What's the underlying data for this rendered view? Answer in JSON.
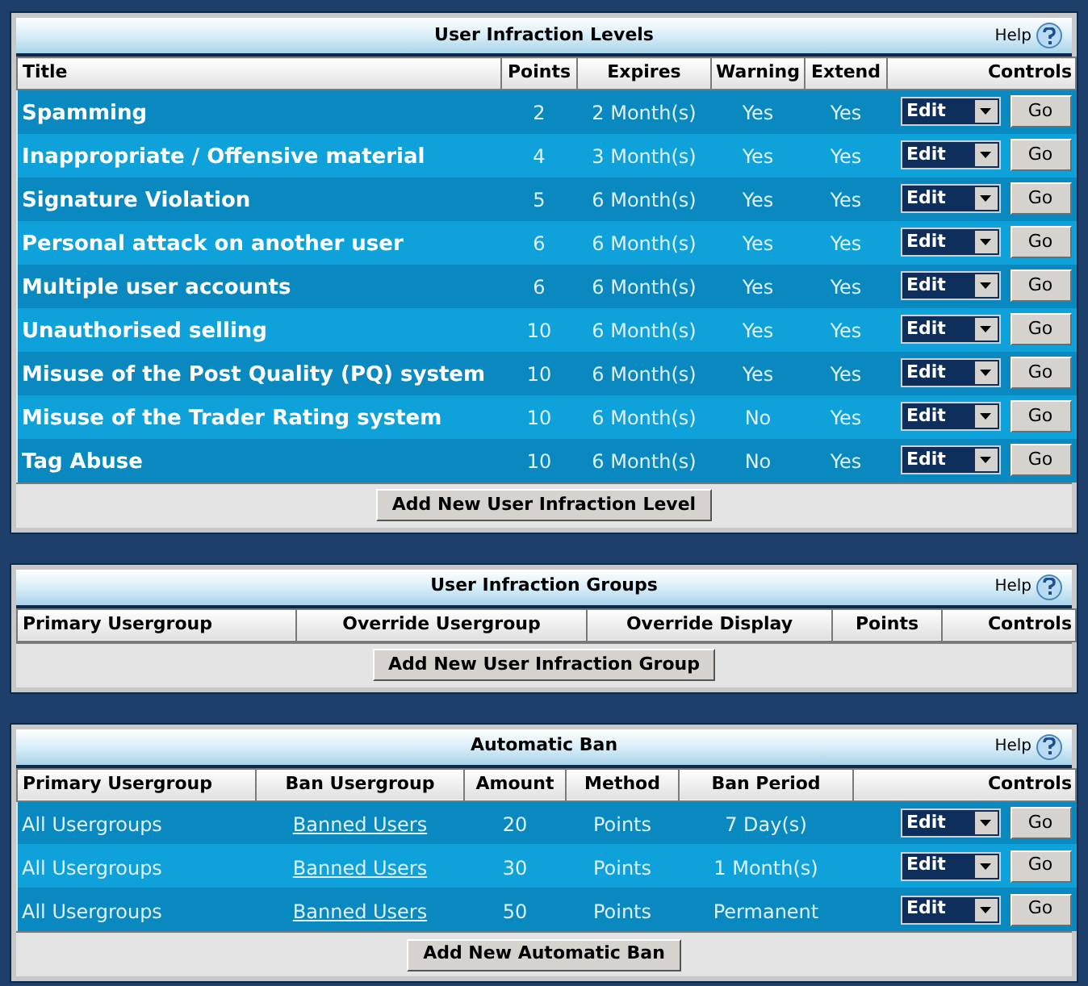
{
  "sections": [
    {
      "title": "User Infraction Levels",
      "help": "Help",
      "columns": [
        {
          "label": "Title",
          "kind": "title"
        },
        {
          "label": "Points",
          "kind": "text"
        },
        {
          "label": "Expires",
          "kind": "text"
        },
        {
          "label": "Warning",
          "kind": "text"
        },
        {
          "label": "Extend",
          "kind": "text"
        },
        {
          "label": "Controls",
          "kind": "controls"
        }
      ],
      "rows": [
        {
          "cells": [
            "Spamming",
            "2",
            "2 Month(s)",
            "Yes",
            "Yes"
          ],
          "select": "Edit",
          "button": "Go"
        },
        {
          "cells": [
            "Inappropriate / Offensive material",
            "4",
            "3 Month(s)",
            "Yes",
            "Yes"
          ],
          "select": "Edit",
          "button": "Go"
        },
        {
          "cells": [
            "Signature Violation",
            "5",
            "6 Month(s)",
            "Yes",
            "Yes"
          ],
          "select": "Edit",
          "button": "Go"
        },
        {
          "cells": [
            "Personal attack on another user",
            "6",
            "6 Month(s)",
            "Yes",
            "Yes"
          ],
          "select": "Edit",
          "button": "Go"
        },
        {
          "cells": [
            "Multiple user accounts",
            "6",
            "6 Month(s)",
            "Yes",
            "Yes"
          ],
          "select": "Edit",
          "button": "Go"
        },
        {
          "cells": [
            "Unauthorised selling",
            "10",
            "6 Month(s)",
            "Yes",
            "Yes"
          ],
          "select": "Edit",
          "button": "Go"
        },
        {
          "cells": [
            "Misuse of the Post Quality (PQ) system",
            "10",
            "6 Month(s)",
            "Yes",
            "Yes"
          ],
          "select": "Edit",
          "button": "Go"
        },
        {
          "cells": [
            "Misuse of the Trader Rating system",
            "10",
            "6 Month(s)",
            "No",
            "Yes"
          ],
          "select": "Edit",
          "button": "Go"
        },
        {
          "cells": [
            "Tag Abuse",
            "10",
            "6 Month(s)",
            "No",
            "Yes"
          ],
          "select": "Edit",
          "button": "Go"
        }
      ],
      "add_button": "Add New User Infraction Level"
    },
    {
      "title": "User Infraction Groups",
      "help": "Help",
      "columns": [
        {
          "label": "Primary Usergroup",
          "kind": "first"
        },
        {
          "label": "Override Usergroup",
          "kind": "text"
        },
        {
          "label": "Override Display",
          "kind": "text"
        },
        {
          "label": "Points",
          "kind": "text"
        },
        {
          "label": "Controls",
          "kind": "controls"
        }
      ],
      "add_button": "Add New User Infraction Group"
    },
    {
      "title": "Automatic Ban",
      "help": "Help",
      "columns": [
        {
          "label": "Primary Usergroup",
          "kind": "first"
        },
        {
          "label": "Ban Usergroup",
          "kind": "link"
        },
        {
          "label": "Amount",
          "kind": "text"
        },
        {
          "label": "Method",
          "kind": "text"
        },
        {
          "label": "Ban Period",
          "kind": "text"
        },
        {
          "label": "Controls",
          "kind": "controls"
        }
      ],
      "rows": [
        {
          "cells": [
            "All Usergroups",
            "Banned Users",
            "20",
            "Points",
            "7 Day(s)"
          ],
          "select": "Edit",
          "button": "Go"
        },
        {
          "cells": [
            "All Usergroups",
            "Banned Users",
            "30",
            "Points",
            "1 Month(s)"
          ],
          "select": "Edit",
          "button": "Go"
        },
        {
          "cells": [
            "All Usergroups",
            "Banned Users",
            "50",
            "Points",
            "Permanent"
          ],
          "select": "Edit",
          "button": "Go"
        }
      ],
      "add_button": "Add New Automatic Ban"
    }
  ]
}
